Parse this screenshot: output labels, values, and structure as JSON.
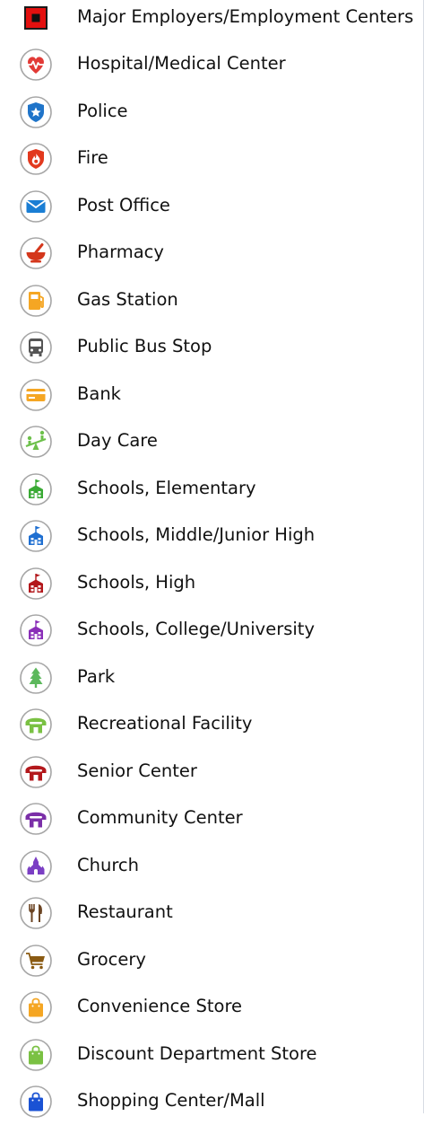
{
  "legend": {
    "items": [
      {
        "label": "Major Employers/Employment Centers",
        "icon": "major-employer-icon",
        "color": "#e3100f"
      },
      {
        "label": "Hospital/Medical Center",
        "icon": "heartbeat-icon",
        "color": "#e23a36"
      },
      {
        "label": "Police",
        "icon": "police-badge-icon",
        "color": "#1f74c9"
      },
      {
        "label": "Fire",
        "icon": "fire-icon",
        "color": "#e2391e"
      },
      {
        "label": "Post Office",
        "icon": "envelope-icon",
        "color": "#1a7ed4"
      },
      {
        "label": "Pharmacy",
        "icon": "mortar-pestle-icon",
        "color": "#d4371c"
      },
      {
        "label": "Gas Station",
        "icon": "fuel-pump-icon",
        "color": "#f5a623"
      },
      {
        "label": "Public Bus Stop",
        "icon": "bus-icon",
        "color": "#555555"
      },
      {
        "label": "Bank",
        "icon": "credit-card-icon",
        "color": "#f5a623"
      },
      {
        "label": "Day Care",
        "icon": "seesaw-icon",
        "color": "#6cc04a"
      },
      {
        "label": "Schools, Elementary",
        "icon": "school-elementary-icon",
        "color": "#3aaa35"
      },
      {
        "label": "Schools, Middle/Junior High",
        "icon": "school-middle-icon",
        "color": "#1f6fd1"
      },
      {
        "label": "Schools, High",
        "icon": "school-high-icon",
        "color": "#b3181c"
      },
      {
        "label": "Schools, College/University",
        "icon": "school-college-icon",
        "color": "#8a2fb8"
      },
      {
        "label": "Park",
        "icon": "tree-icon",
        "color": "#5cb85c"
      },
      {
        "label": "Recreational Facility",
        "icon": "recreation-icon",
        "color": "#7ac143"
      },
      {
        "label": "Senior Center",
        "icon": "senior-center-icon",
        "color": "#b3181c"
      },
      {
        "label": "Community Center",
        "icon": "community-center-icon",
        "color": "#7b2fa8"
      },
      {
        "label": "Church",
        "icon": "church-icon",
        "color": "#7b3fc4"
      },
      {
        "label": "Restaurant",
        "icon": "fork-knife-icon",
        "color": "#6b4423"
      },
      {
        "label": "Grocery",
        "icon": "shopping-cart-icon",
        "color": "#8a5a12"
      },
      {
        "label": "Convenience Store",
        "icon": "shopping-bag-icon",
        "color": "#f5a623"
      },
      {
        "label": "Discount Department Store",
        "icon": "shopping-bag-icon",
        "color": "#7ac143"
      },
      {
        "label": "Shopping Center/Mall",
        "icon": "shopping-bag-icon",
        "color": "#1a52d4"
      }
    ]
  }
}
